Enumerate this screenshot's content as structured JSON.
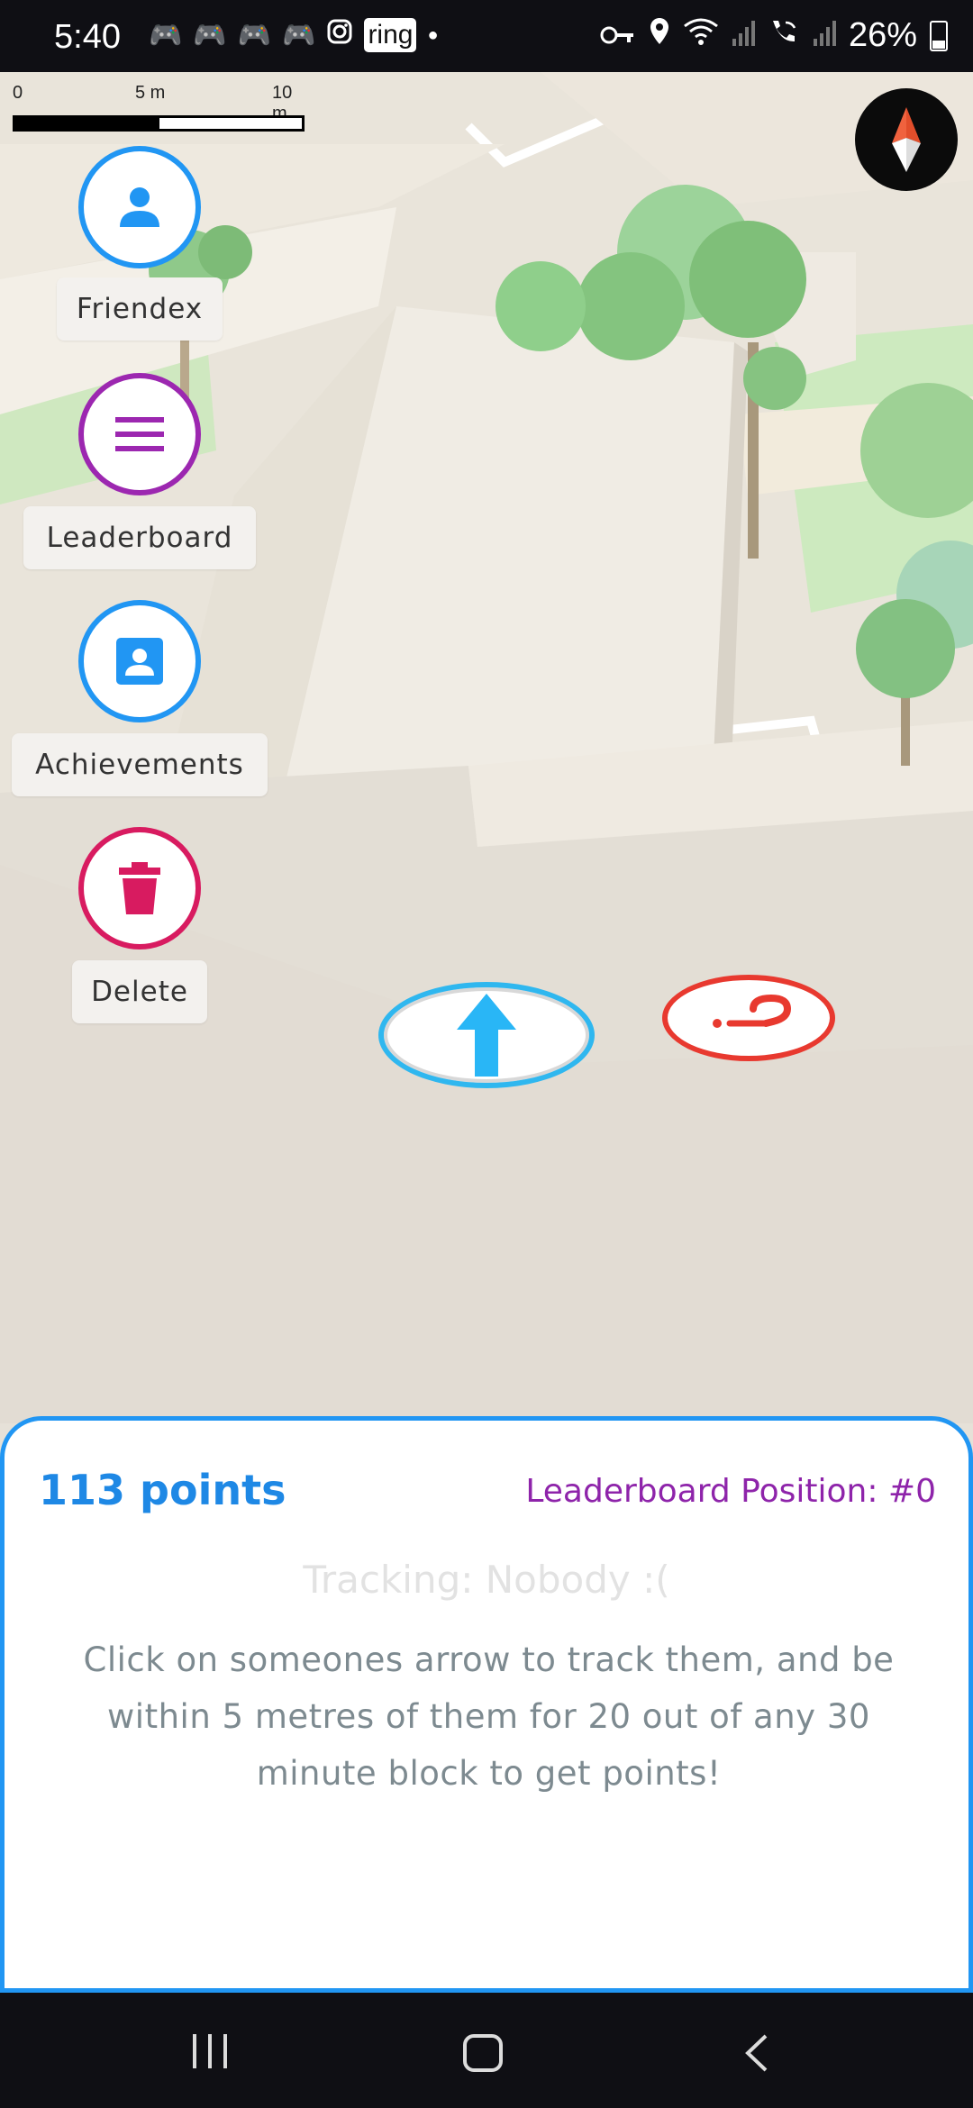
{
  "status_bar": {
    "time": "5:40",
    "ring_label": "ring",
    "battery": "26%",
    "left_icons": [
      "discord-icon",
      "discord-icon",
      "discord-icon",
      "discord-icon",
      "instagram-icon",
      "ring-icon",
      "dot-icon"
    ],
    "right_icons": [
      "vpn-key-icon",
      "location-icon",
      "wifi-icon",
      "signal-icon",
      "wifi-calling-icon",
      "signal-icon",
      "battery-icon"
    ]
  },
  "scale": {
    "labels": [
      "0",
      "5 m",
      "10 m"
    ]
  },
  "menu": {
    "items": [
      {
        "label": "Friendex",
        "icon": "person-icon",
        "color": "#2196f3"
      },
      {
        "label": "Leaderboard",
        "icon": "menu-lines-icon",
        "color": "#9c27b0"
      },
      {
        "label": "Achievements",
        "icon": "contact-card-icon",
        "color": "#2196f3"
      },
      {
        "label": "Delete",
        "icon": "trash-icon",
        "color": "#d81b60"
      }
    ]
  },
  "panel": {
    "points": "113 points",
    "leaderboard_position": "Leaderboard Position: #0",
    "tracking": "Tracking: Nobody :(",
    "instructions": "Click on someones arrow to track them, and be within 5 metres of them for 20 out of any 30 minute block to get points!"
  },
  "colors": {
    "accent": "#2196f3",
    "purple": "#8e24aa",
    "delete": "#d81b60",
    "unknown_marker": "#e8392f",
    "arrow_marker": "#2fb7ef"
  },
  "nav_bar": {
    "buttons": [
      "recents-icon",
      "home-icon",
      "back-icon"
    ]
  }
}
